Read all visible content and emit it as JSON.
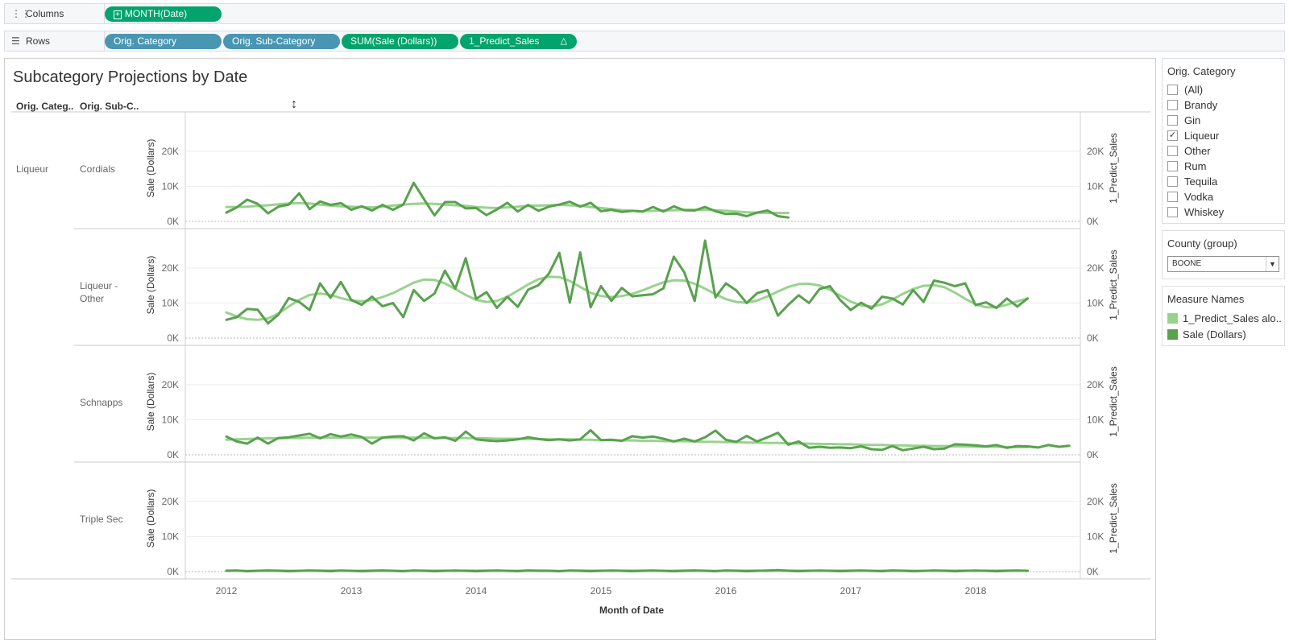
{
  "columns_shelf": {
    "label": "Columns",
    "icon": "columns-icon",
    "pills": [
      {
        "text": "MONTH(Date)",
        "kind": "measure-date"
      }
    ]
  },
  "rows_shelf": {
    "label": "Rows",
    "icon": "rows-icon",
    "pills": [
      {
        "text": "Orig. Category",
        "kind": "dimension"
      },
      {
        "text": "Orig. Sub-Category",
        "kind": "dimension"
      },
      {
        "text": "SUM(Sale (Dollars))",
        "kind": "measure"
      },
      {
        "text": "1_Predict_Sales",
        "kind": "measure",
        "badge": "△"
      }
    ]
  },
  "view": {
    "title": "Subcategory Projections by Date",
    "header_category": "Orig. Categ..",
    "header_subcategory": "Orig. Sub-C..",
    "category_value": "Liqueur",
    "x_axis_title": "Month of Date"
  },
  "filters": {
    "category": {
      "title": "Orig. Category",
      "items": [
        {
          "label": "(All)",
          "checked": false
        },
        {
          "label": "Brandy",
          "checked": false
        },
        {
          "label": "Gin",
          "checked": false
        },
        {
          "label": "Liqueur",
          "checked": true
        },
        {
          "label": "Other",
          "checked": false
        },
        {
          "label": "Rum",
          "checked": false
        },
        {
          "label": "Tequila",
          "checked": false
        },
        {
          "label": "Vodka",
          "checked": false
        },
        {
          "label": "Whiskey",
          "checked": false
        }
      ]
    },
    "county": {
      "title": "County (group)",
      "value": "BOONE"
    }
  },
  "legend": {
    "title": "Measure Names",
    "items": [
      {
        "label": "1_Predict_Sales alo..",
        "color": "#98d38d"
      },
      {
        "label": "Sale (Dollars)",
        "color": "#59a14f"
      }
    ]
  },
  "colors": {
    "actual": "#59a14f",
    "predicted": "#98d38d",
    "dimension_pill": "#4996b2",
    "measure_pill": "#00a46c"
  },
  "chart_data": {
    "type": "line",
    "x_start": "2012-01",
    "x_interval": "month",
    "x_ticks": [
      "2012",
      "2013",
      "2014",
      "2015",
      "2016",
      "2017",
      "2018"
    ],
    "y_ticks": [
      "0K",
      "10K",
      "20K"
    ],
    "ylim": [
      0,
      28000
    ],
    "ylabel_left": "Sale (Dollars)",
    "ylabel_right": "1_Predict_Sales",
    "xlabel": "Month of Date",
    "panels": [
      {
        "subcategory": "Cordials",
        "series": [
          {
            "name": "Sale (Dollars)",
            "values": [
              2500,
              4000,
              6200,
              5000,
              2300,
              4200,
              4800,
              8000,
              3500,
              5700,
              4700,
              5200,
              3300,
              4300,
              3100,
              4700,
              3300,
              4800,
              11000,
              6300,
              1700,
              5500,
              5500,
              3700,
              3800,
              1800,
              3400,
              5300,
              2800,
              4700,
              3000,
              4200,
              4800,
              5600,
              4200,
              5300,
              2900,
              3300,
              2700,
              3000,
              2800,
              4100,
              2800,
              4300,
              3200,
              3100,
              4100,
              2900,
              2100,
              2200,
              1500,
              2500,
              3100,
              1500,
              1100
            ]
          },
          {
            "name": "1_Predict_Sales",
            "values": [
              4100,
              4100,
              4200,
              4400,
              4600,
              4900,
              5100,
              5200,
              5100,
              4800,
              4500,
              4300,
              4200,
              4100,
              4000,
              4200,
              4500,
              4800,
              5000,
              5100,
              5000,
              4800,
              4600,
              4400,
              4100,
              3900,
              3800,
              4000,
              4200,
              4400,
              4500,
              4600,
              4700,
              4600,
              4400,
              4100,
              3800,
              3500,
              3200,
              3000,
              2900,
              3000,
              3100,
              3200,
              3300,
              3300,
              3300,
              3200,
              3000,
              2800,
              2600,
              2500,
              2400,
              2400,
              2400
            ]
          }
        ]
      },
      {
        "subcategory": "Liqueur - Other",
        "series": [
          {
            "name": "Sale (Dollars)",
            "values": [
              5200,
              6000,
              8300,
              8100,
              4200,
              6700,
              11400,
              10300,
              8000,
              15600,
              11500,
              16000,
              10900,
              9500,
              11800,
              9100,
              10000,
              6000,
              13700,
              10600,
              12700,
              19200,
              14100,
              22800,
              11200,
              13100,
              8600,
              11800,
              8900,
              13800,
              15100,
              18400,
              24300,
              10100,
              24400,
              8800,
              14800,
              10600,
              14300,
              11900,
              12200,
              12500,
              14200,
              23200,
              18800,
              10600,
              27800,
              11600,
              15600,
              13600,
              10000,
              12800,
              13700,
              6400,
              9500,
              12200,
              10000,
              14000,
              14800,
              10800,
              8000,
              10100,
              8400,
              11800,
              11300,
              9600,
              13700,
              10300,
              16400,
              15800,
              14800,
              15600,
              9400,
              10200,
              8600,
              11300,
              9000,
              11300
            ]
          },
          {
            "name": "1_Predict_Sales",
            "values": [
              7300,
              6200,
              5400,
              5200,
              5600,
              7000,
              9000,
              10900,
              12300,
              12700,
              12300,
              11400,
              10700,
              10500,
              10800,
              11700,
              12800,
              14300,
              15800,
              16700,
              16600,
              15600,
              14000,
              12300,
              10900,
              10300,
              10600,
              11800,
              13500,
              15300,
              16800,
              17500,
              17400,
              16300,
              14600,
              12900,
              12000,
              11700,
              12000,
              12600,
              13600,
              14800,
              15900,
              16500,
              16400,
              15500,
              14100,
              12500,
              11100,
              10300,
              10100,
              10700,
              11900,
              13300,
              14600,
              15400,
              15500,
              15000,
              13800,
              12100,
              10400,
              9300,
              9000,
              9600,
              11000,
              12600,
              14000,
              14900,
              15100,
              14500,
              13000,
              11200,
              9600,
              8800,
              8800,
              9500,
              10500,
              11300
            ]
          }
        ]
      },
      {
        "subcategory": "Schnapps",
        "series": [
          {
            "name": "Sale (Dollars)",
            "values": [
              5200,
              3800,
              3200,
              4900,
              3200,
              4800,
              5000,
              5500,
              6000,
              4700,
              5900,
              5200,
              5800,
              5100,
              3200,
              4900,
              5200,
              5300,
              4100,
              6100,
              4700,
              5000,
              4000,
              6600,
              4400,
              4100,
              3900,
              4100,
              4400,
              5000,
              4500,
              4200,
              4400,
              4100,
              4400,
              7000,
              4200,
              4300,
              4000,
              5300,
              4900,
              5200,
              4600,
              3800,
              4600,
              3800,
              5000,
              6900,
              4300,
              3700,
              5400,
              3800,
              5000,
              6300,
              2900,
              3800,
              2000,
              2300,
              2000,
              2100,
              1900,
              2400,
              1600,
              1400,
              2500,
              1300,
              1800,
              2300,
              1600,
              1800,
              3000,
              2900,
              2700,
              2400,
              2800,
              2000,
              2500,
              2400,
              2100,
              2800,
              2300,
              2600
            ]
          },
          {
            "name": "1_Predict_Sales",
            "values": [
              4300,
              4400,
              4500,
              4600,
              4700,
              4700,
              4800,
              4800,
              4900,
              4900,
              4900,
              4900,
              4900,
              4900,
              4900,
              4900,
              4900,
              4900,
              4900,
              4900,
              4800,
              4800,
              4800,
              4800,
              4700,
              4700,
              4600,
              4600,
              4600,
              4500,
              4500,
              4400,
              4400,
              4400,
              4300,
              4300,
              4200,
              4200,
              4100,
              4100,
              4000,
              4000,
              3900,
              3900,
              3900,
              3800,
              3700,
              3700,
              3600,
              3600,
              3500,
              3500,
              3400,
              3400,
              3300,
              3200,
              3200,
              3100,
              3100,
              3000,
              3000,
              2900,
              2800,
              2800,
              2700,
              2700,
              2600,
              2600,
              2500,
              2500,
              2400,
              2400,
              2300,
              2300,
              2300,
              2200,
              2200,
              2200
            ]
          }
        ]
      },
      {
        "subcategory": "Triple Sec",
        "series": [
          {
            "name": "Sale (Dollars)",
            "values": [
              200,
              300,
              100,
              200,
              300,
              200,
              100,
              200,
              300,
              200,
              100,
              300,
              200,
              100,
              200,
              300,
              200,
              100,
              300,
              200,
              100,
              200,
              300,
              200,
              100,
              200,
              300,
              200,
              100,
              300,
              200,
              200,
              100,
              300,
              200,
              100,
              200,
              300,
              200,
              100,
              200,
              300,
              200,
              100,
              200,
              300,
              200,
              100,
              300,
              200,
              100,
              200,
              300,
              400,
              200,
              100,
              200,
              300,
              200,
              100,
              200,
              300,
              200,
              100,
              300,
              200,
              100,
              200,
              300,
              200,
              100,
              200,
              300,
              200,
              100,
              200,
              300,
              200
            ]
          },
          {
            "name": "1_Predict_Sales",
            "values": [
              300,
              250,
              200,
              250,
              300,
              300,
              250,
              200,
              250,
              300,
              300,
              250,
              200,
              250,
              300,
              300,
              250,
              200,
              250,
              300,
              300,
              250,
              200,
              250,
              300,
              300,
              250,
              200,
              250,
              300,
              300,
              250,
              200,
              250,
              300,
              300,
              250,
              200,
              250,
              300,
              300,
              250,
              200,
              250,
              300,
              300,
              250,
              200,
              250,
              300,
              300,
              250,
              200,
              250,
              300,
              300,
              250,
              200,
              250,
              300,
              300,
              250,
              200,
              250,
              300,
              300,
              250,
              200,
              250,
              300,
              300,
              250,
              200,
              250,
              300,
              300,
              250,
              200
            ]
          }
        ]
      }
    ]
  }
}
